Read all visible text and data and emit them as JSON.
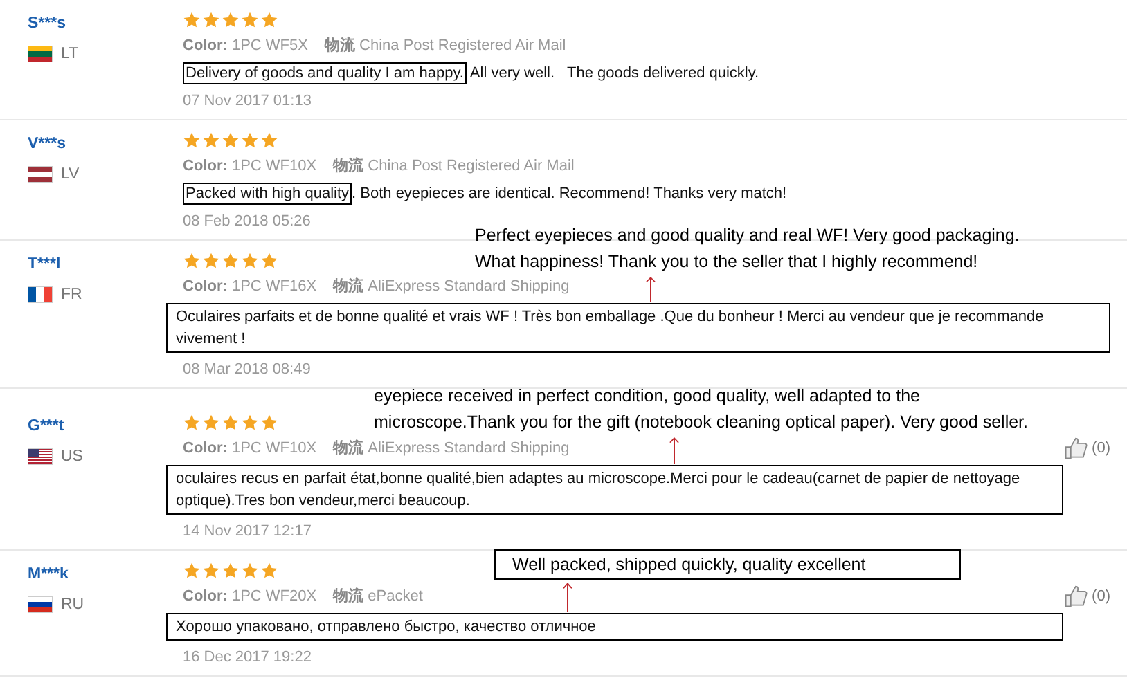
{
  "reviews": [
    {
      "name": "S***s",
      "country": "LT",
      "flag": {
        "kind": "lt"
      },
      "stars": 5,
      "color_label": "Color:",
      "color_value": "1PC WF5X",
      "shipping_label": "物流",
      "shipping": "China Post Registered Air Mail",
      "text_parts": [
        {
          "text": "Delivery of goods and quality I am happy.",
          "boxed": true
        },
        {
          "text": " All very well.   The goods delivered quickly.",
          "boxed": false
        }
      ],
      "date": "07 Nov 2017 01:13"
    },
    {
      "name": "V***s",
      "country": "LV",
      "flag": {
        "kind": "lv"
      },
      "stars": 5,
      "color_label": "Color:",
      "color_value": "1PC WF10X",
      "shipping_label": "物流",
      "shipping": "China Post Registered Air Mail",
      "text_parts": [
        {
          "text": "Packed with high quality",
          "boxed": true
        },
        {
          "text": ". Both eyepieces are identical. Recommend! Thanks very match!",
          "boxed": false
        }
      ],
      "date": "08 Feb 2018 05:26"
    },
    {
      "name": "T***l",
      "country": "FR",
      "flag": {
        "kind": "fr"
      },
      "stars": 5,
      "color_label": "Color:",
      "color_value": "1PC WF16X",
      "shipping_label": "物流",
      "shipping": "AliExpress Standard Shipping",
      "text_parts": [
        {
          "text": "Oculaires parfaits et de bonne qualité et vrais WF ! Très bon emballage .Que du bonheur ! Merci au vendeur que je recommande vivement !",
          "boxed": true
        }
      ],
      "date": "08 Mar 2018 08:49",
      "translation": {
        "lines": [
          "Perfect eyepieces and good quality and real WF! Very good packaging.",
          "What happiness! Thank you to the seller that I highly recommend!"
        ],
        "boxed": false
      }
    },
    {
      "name": "G***t",
      "country": "US",
      "flag": {
        "kind": "us"
      },
      "stars": 5,
      "color_label": "Color:",
      "color_value": "1PC WF10X",
      "shipping_label": "物流",
      "shipping": "AliExpress Standard Shipping",
      "text_parts": [
        {
          "text": "oculaires recus en parfait état,bonne qualité,bien adaptes au microscope.Merci pour le cadeau(carnet de papier de nettoyage optique).Tres bon vendeur,merci beaucoup.",
          "boxed": true
        }
      ],
      "date": "14 Nov 2017 12:17",
      "likes": "(0)",
      "translation": {
        "lines": [
          "eyepiece received in perfect condition, good quality, well adapted to the",
          "microscope.Thank you for the gift (notebook cleaning optical paper). Very good seller."
        ],
        "boxed": false
      }
    },
    {
      "name": "M***k",
      "country": "RU",
      "flag": {
        "kind": "ru"
      },
      "stars": 5,
      "color_label": "Color:",
      "color_value": "1PC WF20X",
      "shipping_label": "物流",
      "shipping": "ePacket",
      "text_parts": [
        {
          "text": "Хорошо упаковано, отправлено быстро, качество отличное",
          "boxed": true
        }
      ],
      "date": "16 Dec 2017 19:22",
      "likes": "(0)",
      "translation": {
        "lines": [
          "Well packed, shipped quickly, quality excellent"
        ],
        "boxed": true
      }
    }
  ]
}
